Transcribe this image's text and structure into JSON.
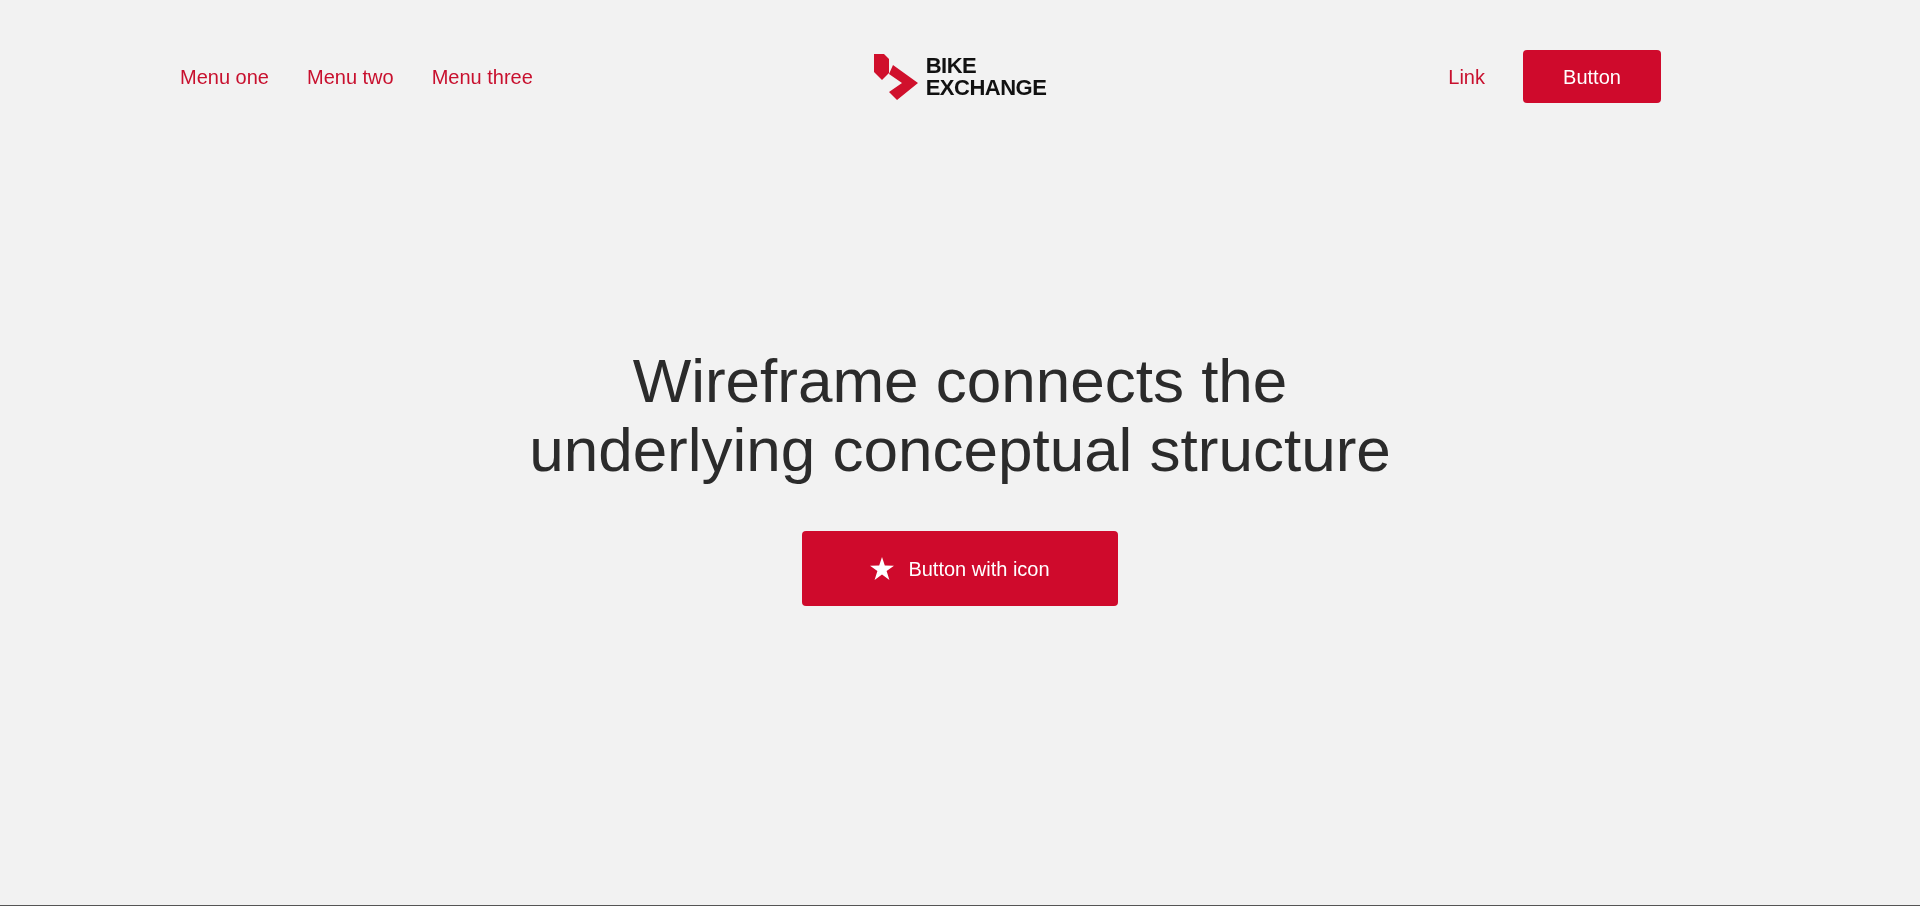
{
  "nav": {
    "menu": [
      "Menu one",
      "Menu two",
      "Menu three"
    ],
    "logo": {
      "lines": [
        "BIKE",
        "EXCHANGE"
      ]
    },
    "link": "Link",
    "button": "Button"
  },
  "hero": {
    "heading": [
      "Wireframe connects the",
      "underlying conceptual structure"
    ],
    "button": {
      "label": "Button with icon"
    }
  }
}
